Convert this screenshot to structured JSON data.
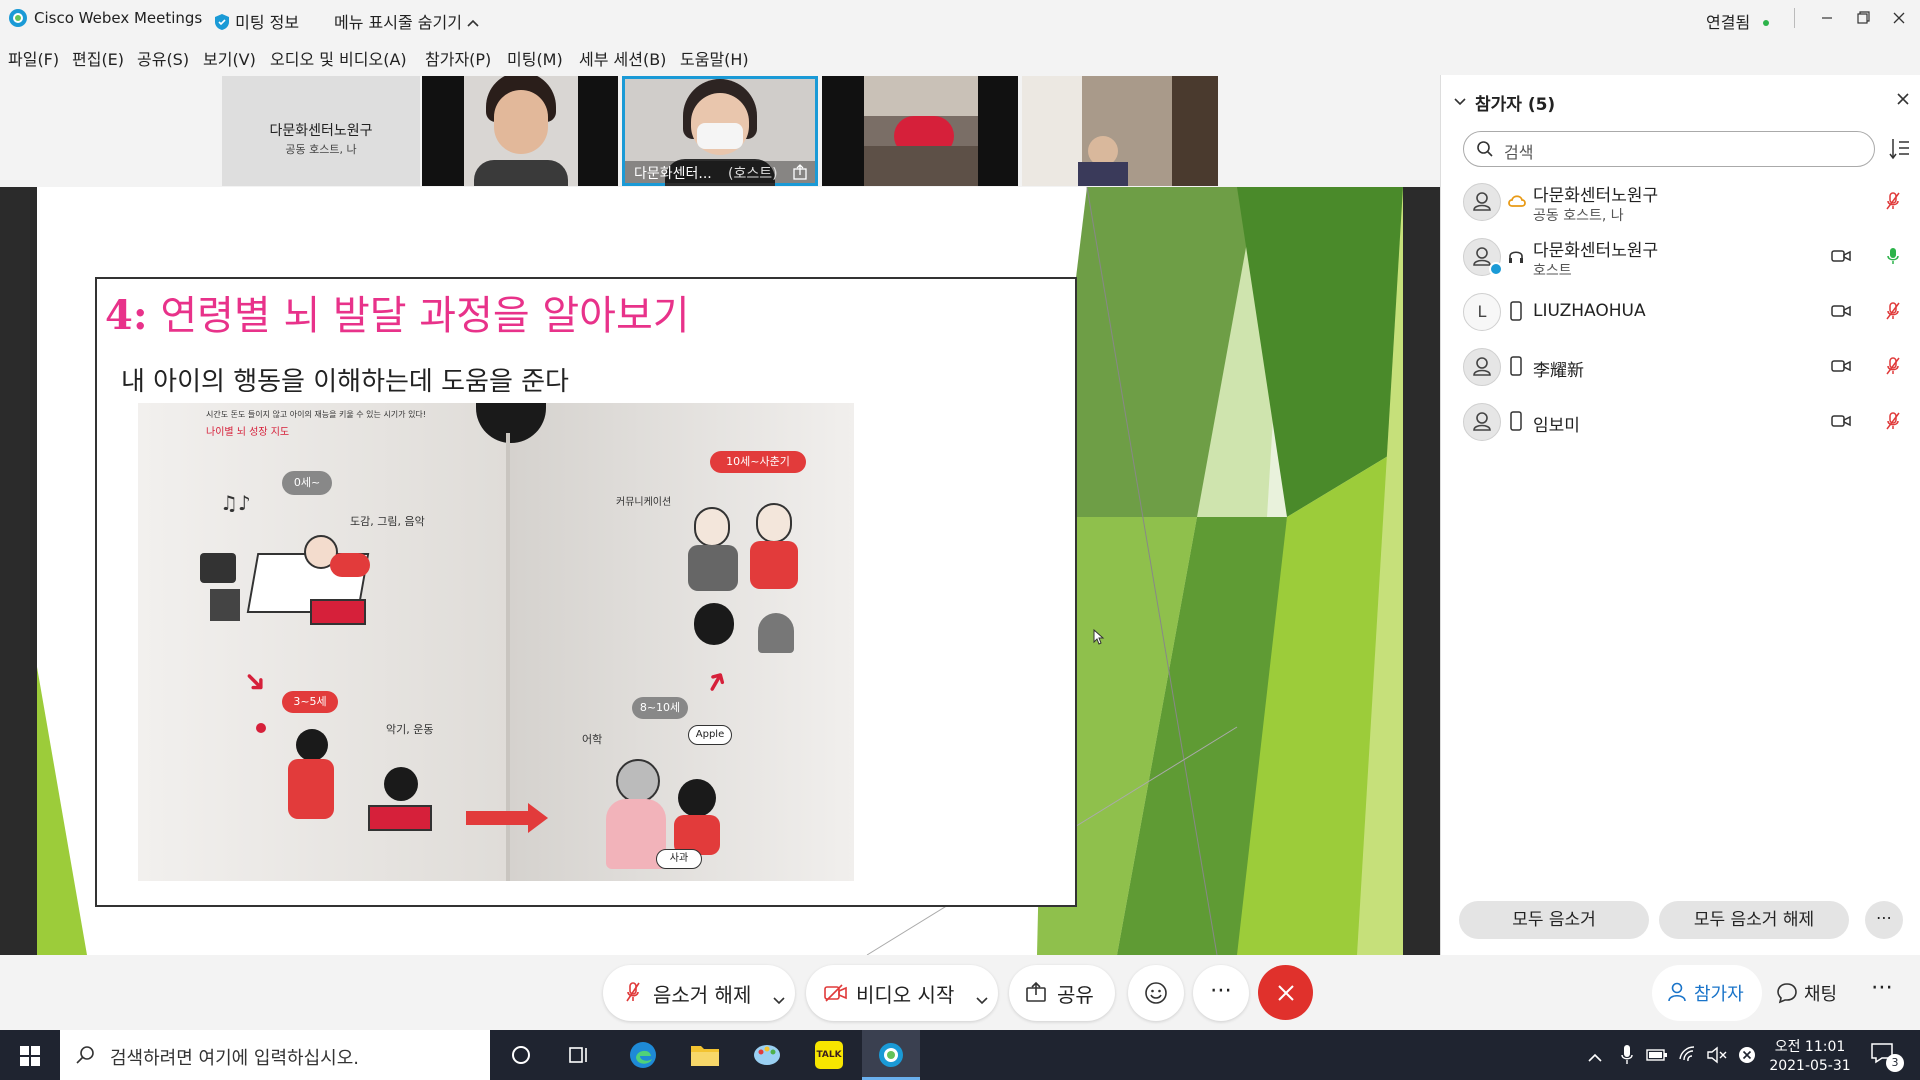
{
  "titlebar": {
    "app_title": "Cisco Webex Meetings",
    "meeting_info": "미팅 정보",
    "hide_menu": "메뉴 표시줄 숨기기",
    "connected": "연결됨"
  },
  "menu": [
    "파일(F)",
    "편집(E)",
    "공유(S)",
    "보기(V)",
    "오디오 및 비디오(A)",
    "참가자(P)",
    "미팅(M)",
    "세부 세션(B)",
    "도움말(H)"
  ],
  "thumbnails": {
    "first_name": "다문화센터노원구",
    "first_role": "공동 호스트, 나",
    "active_label": "다문화센터...",
    "active_role": "(호스트)"
  },
  "slide": {
    "title_number": "4:",
    "title_text": "연령별  뇌 발달 과정을 알아보기",
    "subtitle": "내 아이의  행동을  이해하는데 도움을 준다",
    "book": {
      "heading_small": "시간도 돈도 들이지 않고 아이의 재능을 키울 수 있는 시기가 있다!",
      "heading_red": "나이별 뇌 성장 지도",
      "bubble_0": "0세~",
      "label_0": "도감, 그림, 음악",
      "bubble_3": "3~5세",
      "label_3": "악기, 운동",
      "bubble_8": "8~10세",
      "label_8": "어학",
      "apple": "Apple",
      "sagwa": "사과",
      "bubble_10": "10세~사춘기",
      "label_10": "커뮤니케이션"
    }
  },
  "panel": {
    "title": "참가자 (5)",
    "search_placeholder": "검색",
    "participants": [
      {
        "name": "다문화센터노원구",
        "role": "공동 호스트, 나"
      },
      {
        "name": "다문화센터노원구",
        "role": "호스트"
      },
      {
        "name": "LIUZHAOHUA",
        "role": "",
        "initial": "L"
      },
      {
        "name": "李耀新",
        "role": ""
      },
      {
        "name": "임보미",
        "role": ""
      }
    ],
    "mute_all": "모두 음소거",
    "unmute_all": "모두 음소거 해제"
  },
  "controls": {
    "unmute": "음소거 해제",
    "start_video": "비디오 시작",
    "share": "공유",
    "participants": "참가자",
    "chat": "채팅"
  },
  "taskbar": {
    "search_placeholder": "검색하려면 여기에 입력하십시오.",
    "time": "오전 11:01",
    "date": "2021-05-31",
    "notif_count": "3",
    "kakao": "TALK"
  },
  "colors": {
    "accent_blue": "#1a9ad6",
    "leave_red": "#e0312c",
    "mute_red": "#e03a3a",
    "slide_pink": "#e8328a",
    "green_dark": "#4a8a2a",
    "green_light": "#9ccc3a"
  }
}
